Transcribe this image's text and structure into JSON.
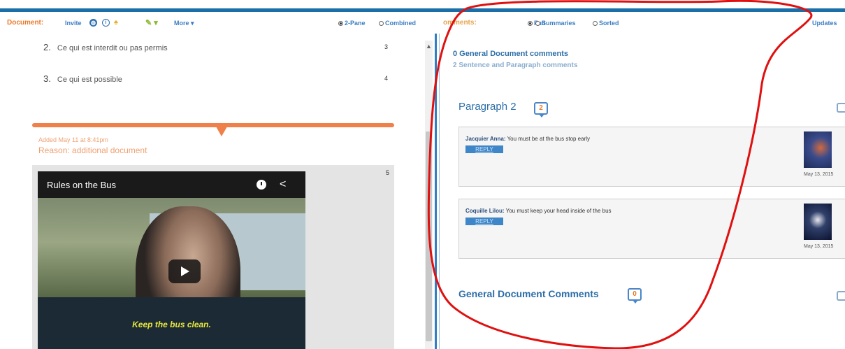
{
  "toolbar": {
    "document_label": "Document:",
    "invite_label": "Invite",
    "info_icon_glyph": "i",
    "more_label": "More ▾",
    "view_options": [
      "2-Pane",
      "Combined"
    ],
    "selected_view": "2-Pane",
    "comments_label": "omments:",
    "comment_options": [
      "Full",
      "Summaries",
      "Sorted"
    ],
    "selected_comment_option": "Full",
    "updates_label": "Updates"
  },
  "outline": [
    {
      "number": "2.",
      "text": "Ce qui est interdit ou pas permis",
      "count": "3"
    },
    {
      "number": "3.",
      "text": "Ce qui est possible",
      "count": "4"
    }
  ],
  "addition": {
    "added": "Added May 11 at 8:41pm",
    "reason": "Reason: additional document",
    "paragraph_number": "5"
  },
  "video": {
    "title": "Rules on the Bus",
    "subtitle": "Keep the bus clean."
  },
  "comments_panel": {
    "general_count": "0 General Document comments",
    "sentence_count": "2 Sentence and Paragraph comments",
    "paragraph_heading": "Paragraph 2",
    "paragraph_comment_count": "2",
    "comments": [
      {
        "author": "Jacquier Anna:",
        "text": " You must be at the bus stop early",
        "reply_label": "REPLY",
        "date": "May 13, 2015"
      },
      {
        "author": "Coquille Lilou:",
        "text": " You must keep your head inside of the bus",
        "reply_label": "REPLY",
        "date": "May 13, 2015"
      }
    ],
    "general_heading": "General Document Comments",
    "general_comment_count": "0"
  },
  "colors": {
    "accent_blue": "#2c6ea8",
    "accent_orange": "#f0804a",
    "annotation_red": "#e01010"
  }
}
